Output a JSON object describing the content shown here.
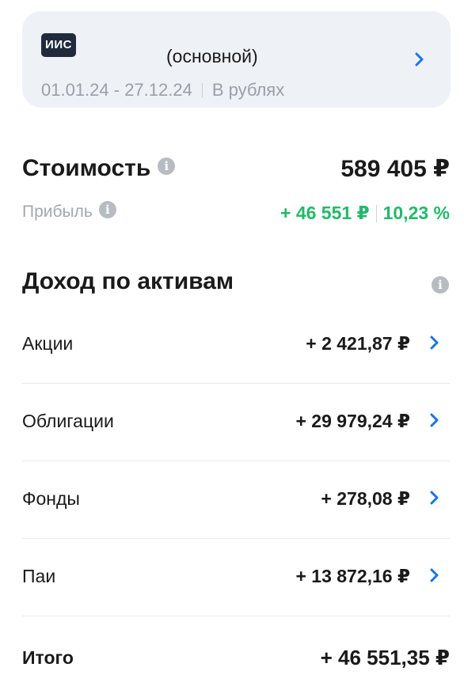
{
  "account": {
    "badge": "ИИС",
    "name": "(основной)",
    "period": "01.01.24 - 27.12.24",
    "currency": "В рублях"
  },
  "value": {
    "title": "Стоимость",
    "amount": "589 405 ₽",
    "profit_label": "Прибыль",
    "profit_amount": "+ 46 551 ₽",
    "profit_percent": "10,23 %"
  },
  "income": {
    "title": "Доход по активам",
    "rows": [
      {
        "label": "Акции",
        "value": "+ 2 421,87 ₽"
      },
      {
        "label": "Облигации",
        "value": "+ 29 979,24 ₽"
      },
      {
        "label": "Фонды",
        "value": "+ 278,08 ₽"
      },
      {
        "label": "Паи",
        "value": "+ 13 872,16 ₽"
      }
    ],
    "total_label": "Итого",
    "total_value": "+ 46 551,35 ₽"
  },
  "icons": {
    "info": "info-icon",
    "chevron": "chevron-right-icon"
  },
  "colors": {
    "accent_blue": "#1a73e8",
    "profit_green": "#24b96a",
    "card_bg": "#eef1f6"
  }
}
